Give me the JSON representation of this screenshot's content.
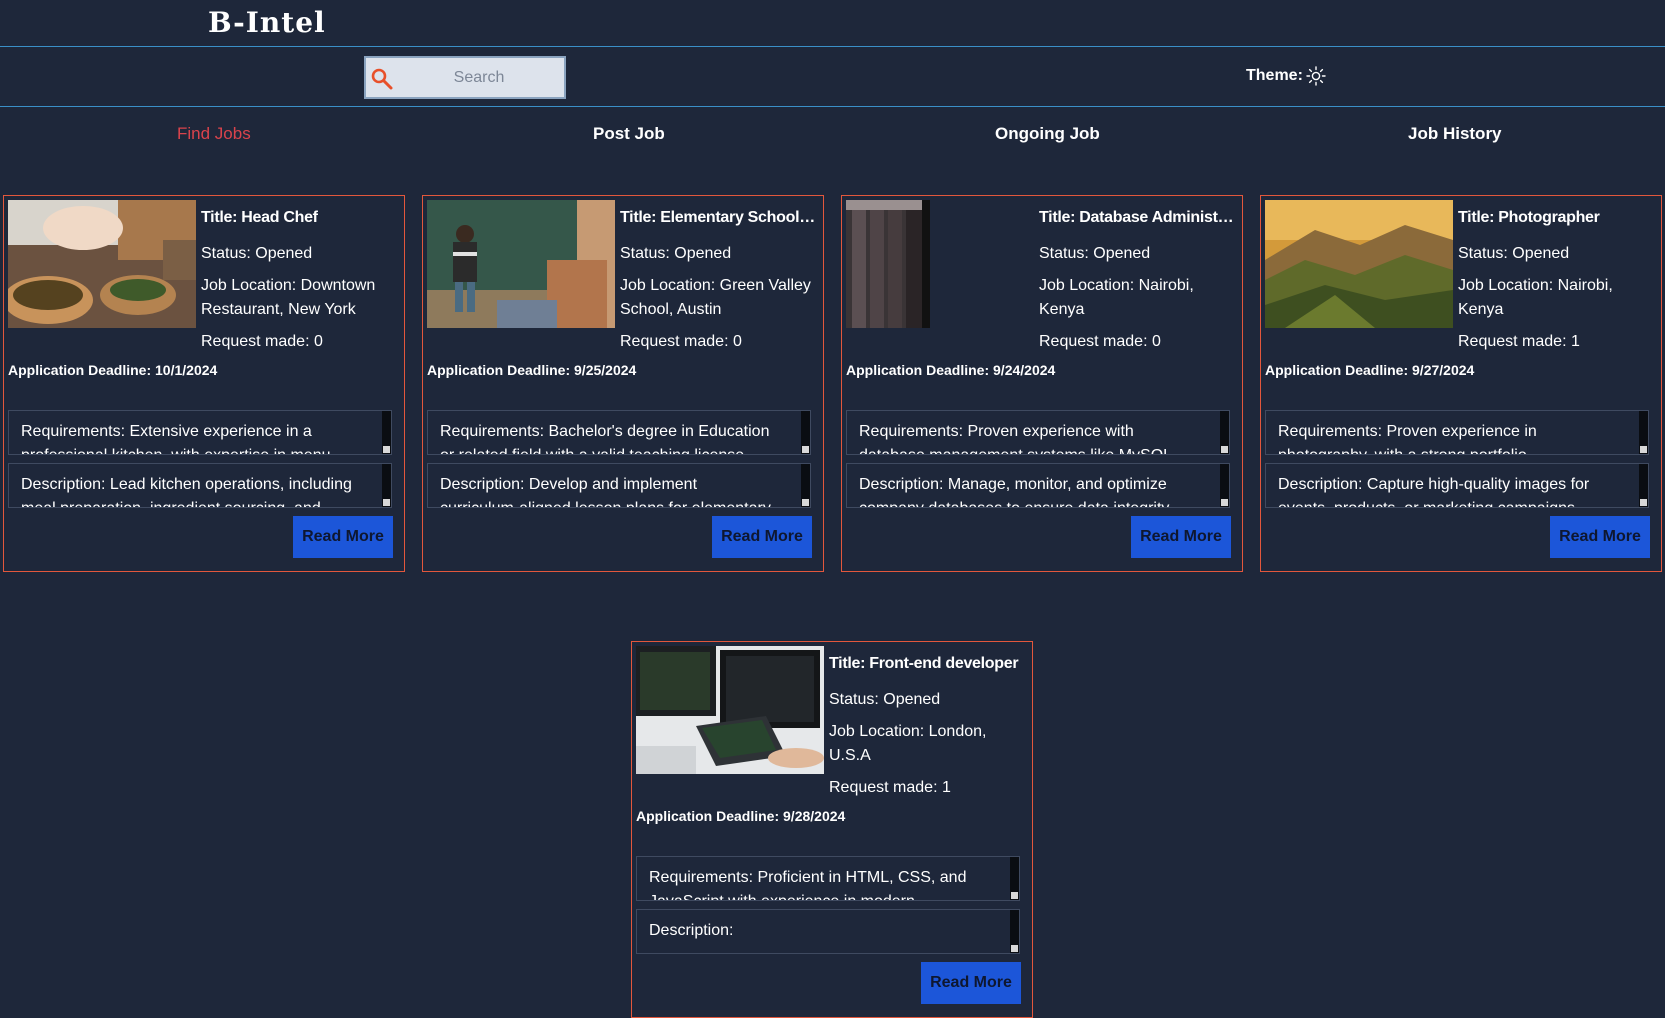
{
  "brand": "B-Intel",
  "search": {
    "placeholder": "Search"
  },
  "theme_label": "Theme:",
  "nav": {
    "find_jobs": "Find Jobs",
    "post_job": "Post Job",
    "ongoing_job": "Ongoing Job",
    "job_history": "Job History"
  },
  "colors": {
    "background": "#1e273a",
    "accent_border": "#e2573c",
    "divider": "#3a8fc7",
    "active_nav": "#d9434c",
    "button": "#1c56d9"
  },
  "jobs": [
    {
      "title": "Title: Head Chef",
      "status": "Status: Opened",
      "location": "Job Location: Downtown Restaurant, New York",
      "requests": "Request made: 0",
      "deadline": "Application Deadline: 10/1/2024",
      "requirements": "Requirements: Extensive experience in a professional kitchen, with expertise in menu",
      "description": "Description: Lead kitchen operations, including meal preparation, ingredient sourcing, and",
      "button": "Read More"
    },
    {
      "title": "Title: Elementary School Teacher",
      "status": "Status: Opened",
      "location": "Job Location: Green Valley School, Austin",
      "requests": "Request made: 0",
      "deadline": "Application Deadline: 9/25/2024",
      "requirements": "Requirements: Bachelor's degree in Education or related field with a valid teaching license",
      "description": "Description: Develop and implement curriculum-aligned lesson plans for elementary",
      "button": "Read More"
    },
    {
      "title": "Title: Database Administrator",
      "status": "Status: Opened",
      "location": "Job Location: Nairobi, Kenya",
      "requests": "Request made: 0",
      "deadline": "Application Deadline: 9/24/2024",
      "requirements": "Requirements: Proven experience with database management systems like MySQL, PostgreSQL",
      "description": "Description: Manage, monitor, and optimize company databases to ensure data integrity and",
      "button": "Read More"
    },
    {
      "title": "Title: Photographer",
      "status": "Status: Opened",
      "location": "Job Location: Nairobi, Kenya",
      "requests": "Request made: 1",
      "deadline": "Application Deadline: 9/27/2024",
      "requirements": "Requirements: Proven experience in photography, with a strong portfolio",
      "description": "Description: Capture high-quality images for events, products, or marketing campaigns",
      "button": "Read More"
    },
    {
      "title": "Title: Front-end developer",
      "status": "Status: Opened",
      "location": "Job Location: London, U.S.A",
      "requests": "Request made: 1",
      "deadline": "Application Deadline: 9/28/2024",
      "requirements": "Requirements: Proficient in HTML, CSS, and JavaScript with experience in modern",
      "description": "Description:",
      "button": "Read More"
    }
  ]
}
